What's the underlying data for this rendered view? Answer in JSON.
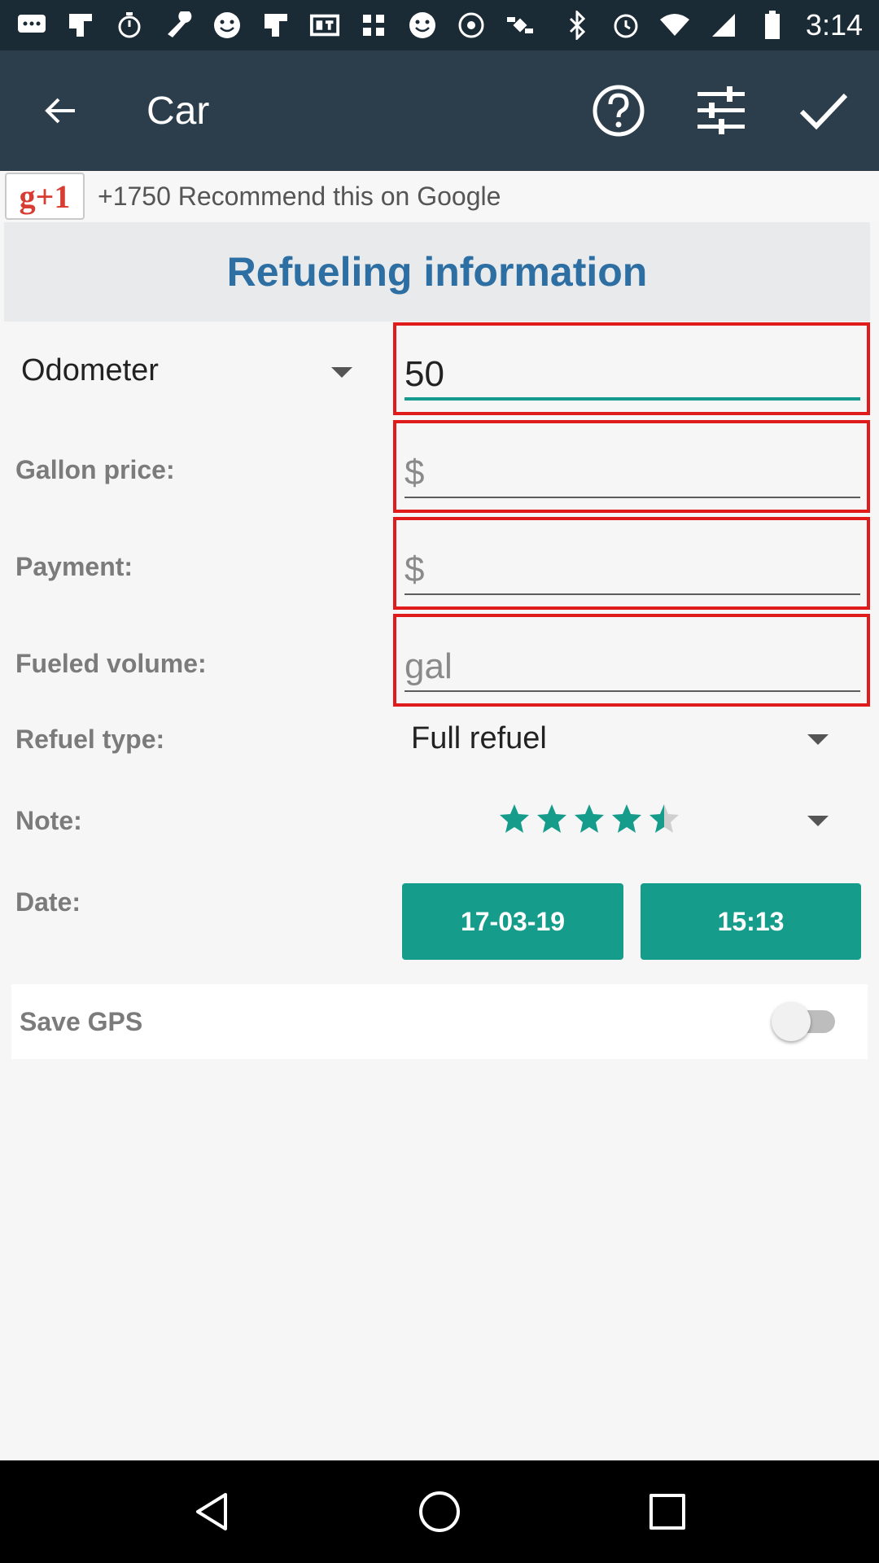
{
  "status_bar": {
    "time": "3:14",
    "left_icons": [
      "message-icon",
      "flipboard-icon",
      "timer-icon",
      "wrench-icon",
      "smiley-icon",
      "flipboard-icon",
      "qt-icon",
      "grid-icon",
      "smiley-icon",
      "radio-icon",
      "satellite-icon"
    ],
    "right_icons": [
      "bluetooth-icon",
      "alarm-icon",
      "wifi-icon",
      "signal-icon",
      "battery-icon"
    ]
  },
  "app_bar": {
    "title": "Car",
    "actions": [
      "help-icon",
      "sliders-icon",
      "check-icon"
    ]
  },
  "google_plus": {
    "button_label": "g+1",
    "text": "+1750 Recommend this on Google"
  },
  "section": {
    "title": "Refueling information"
  },
  "form": {
    "odometer_label": "Odometer",
    "odometer_value": "50",
    "gallon_price_label": "Gallon price:",
    "gallon_price_placeholder": "$",
    "payment_label": "Payment:",
    "payment_placeholder": "$",
    "fueled_volume_label": "Fueled volume:",
    "fueled_volume_placeholder": "gal",
    "refuel_type_label": "Refuel type:",
    "refuel_type_value": "Full refuel",
    "note_label": "Note:",
    "note_rating": 4.5,
    "note_rating_max": 5,
    "date_label": "Date:",
    "date_value": "17-03-19",
    "time_value": "15:13",
    "save_gps_label": "Save GPS",
    "save_gps_on": false
  },
  "colors": {
    "accent": "#159c8b",
    "app_bar": "#2c3e4c",
    "status_bar": "#1b2b36",
    "section_title": "#2d6fa3",
    "error_border": "#e01b1b"
  },
  "nav_bar": {
    "buttons": [
      "back-triangle-icon",
      "home-circle-icon",
      "recents-square-icon"
    ]
  }
}
